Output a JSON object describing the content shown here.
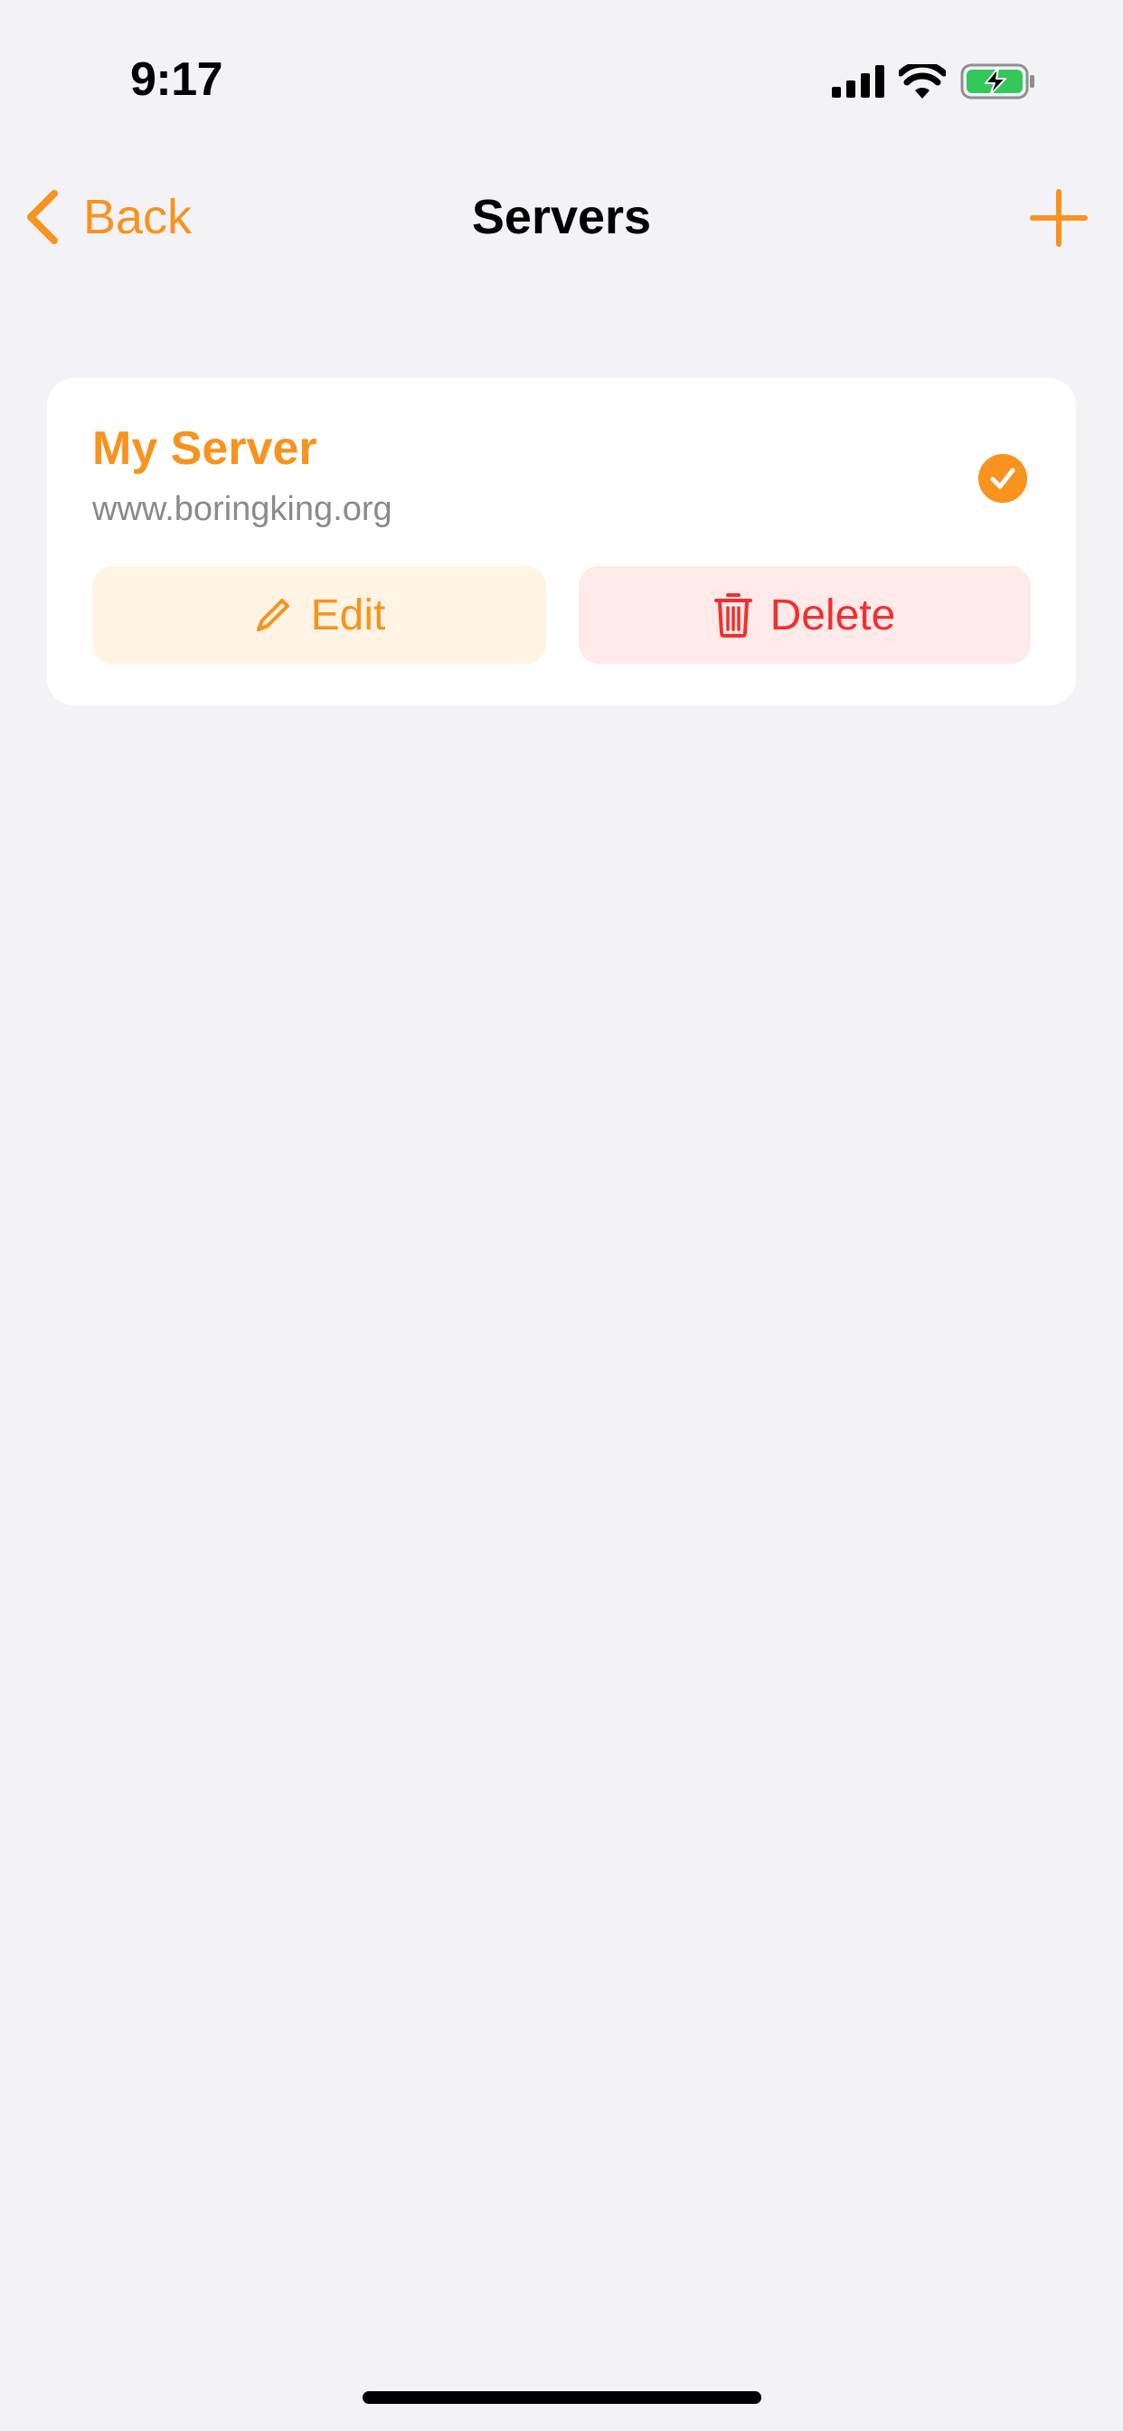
{
  "status_bar": {
    "time": "9:17"
  },
  "nav": {
    "back_label": "Back",
    "title": "Servers"
  },
  "servers": [
    {
      "name": "My Server",
      "url": "www.boringking.org",
      "selected": true,
      "edit_label": "Edit",
      "delete_label": "Delete"
    }
  ],
  "colors": {
    "accent": "#F7931E",
    "destructive": "#F0302F",
    "background": "#F2F2F7",
    "battery_charging": "#34C759"
  },
  "icons": {
    "back": "chevron-left-icon",
    "add": "plus-icon",
    "selected": "checkmark-circle-icon",
    "edit": "pencil-icon",
    "delete": "trash-icon"
  }
}
